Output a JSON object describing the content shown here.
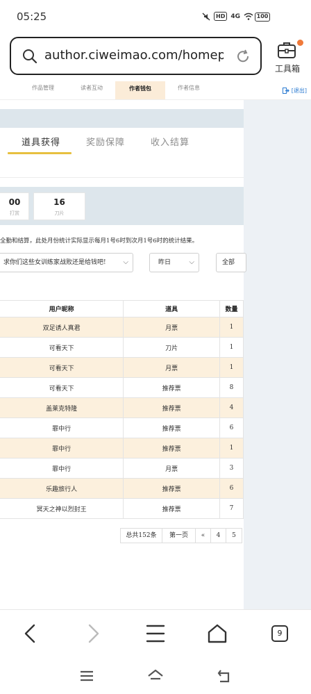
{
  "status_bar": {
    "time": "05:25",
    "hd_badge": "HD",
    "network": "4G",
    "battery": "100"
  },
  "browser": {
    "url": "author.ciweimao.com/homepa···",
    "toolbox_label": "工具箱",
    "tab_count": "9"
  },
  "site_nav": {
    "tabs": [
      "作品管理",
      "读者互动",
      "作者钱包",
      "作者信息"
    ],
    "active_index": 2,
    "logout": "[退出]"
  },
  "inner_tabs": {
    "items": [
      "道具获得",
      "奖励保障",
      "收入结算"
    ],
    "active_index": 0
  },
  "stats": [
    {
      "value": "00",
      "label": "打赏"
    },
    {
      "value": "16",
      "label": "刀片"
    }
  ],
  "note": "全勤和结算，此处月份统计实际显示每月1号6时到次月1号6时的统计结果。",
  "filters": {
    "book": "求你们这些女训练家战败还是给钱吧!",
    "date": "昨日",
    "type": "全部"
  },
  "table": {
    "columns": [
      "用户昵称",
      "道具",
      "数量"
    ],
    "rows": [
      [
        "双足诱人真君",
        "月票",
        "1"
      ],
      [
        "可看天下",
        "刀片",
        "1"
      ],
      [
        "可看天下",
        "月票",
        "1"
      ],
      [
        "可看天下",
        "推荐票",
        "8"
      ],
      [
        "盖莱克特隆",
        "推荐票",
        "4"
      ],
      [
        "罪中行",
        "推荐票",
        "6"
      ],
      [
        "罪中行",
        "推荐票",
        "1"
      ],
      [
        "罪中行",
        "月票",
        "3"
      ],
      [
        "乐趣旅行人",
        "推荐票",
        "6"
      ],
      [
        "冥天之神以烈封王",
        "推荐票",
        "7"
      ]
    ]
  },
  "pagination": {
    "total": "总共152条",
    "first": "第一页",
    "prev": "«",
    "pages": [
      "4",
      "5"
    ]
  },
  "colors": {
    "accent": "#e7c040",
    "row_alt": "#fcf0dd",
    "band": "#dde6ec",
    "notify": "#f07a3a"
  }
}
